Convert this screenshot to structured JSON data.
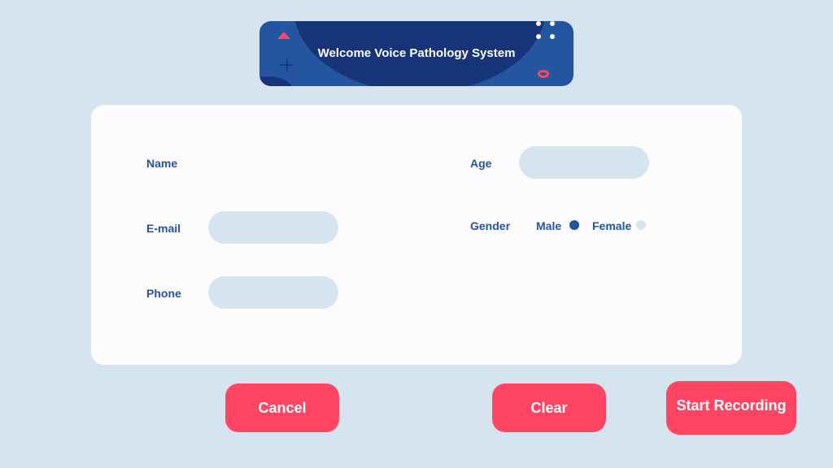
{
  "header": {
    "title": "Welcome Voice Pathology System"
  },
  "form": {
    "name_label": "Name",
    "email_label": "E-mail",
    "phone_label": "Phone",
    "age_label": "Age",
    "gender_label": "Gender",
    "gender_options": [
      {
        "label": "Male",
        "selected": true
      },
      {
        "label": "Female",
        "selected": false
      }
    ],
    "email_value": "",
    "phone_value": "",
    "age_value": ""
  },
  "buttons": {
    "cancel": "Cancel",
    "clear": "Clear",
    "start_recording": "Start Recording"
  },
  "colors": {
    "background": "#d6e4ef",
    "primary_blue": "#245499",
    "dark_blue": "#183479",
    "accent_red": "#ff4563",
    "card": "#fdfbfe"
  }
}
